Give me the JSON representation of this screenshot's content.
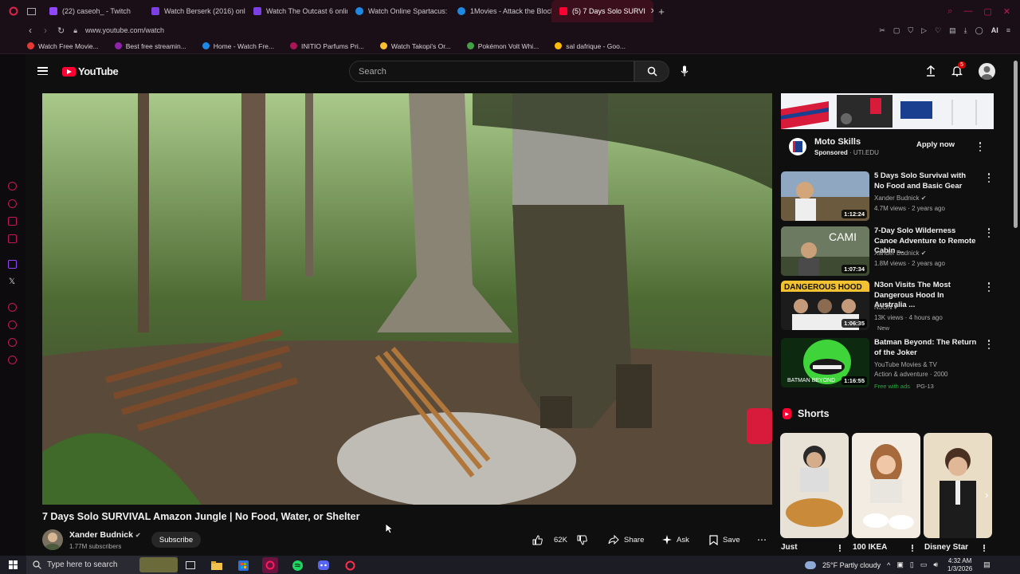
{
  "browser": {
    "tabs": [
      {
        "label": "(22) caseoh_ - Twitch",
        "color": "#9146ff"
      },
      {
        "label": "Watch Berserk (2016) onli",
        "color": "#7b3fe4"
      },
      {
        "label": "Watch The Outcast 6 onlin",
        "color": "#7b3fe4"
      },
      {
        "label": "Watch Online Spartacus: I",
        "color": "#1e88e5"
      },
      {
        "label": "1Movies - Attack the Block",
        "color": "#1e88e5"
      },
      {
        "label": "(5) 7 Days Solo SURVI",
        "color": "#ff0033"
      }
    ],
    "url": "www.youtube.com/watch",
    "bookmarks": [
      {
        "label": "Watch Free Movie...",
        "color": "#e53935"
      },
      {
        "label": "Best free streamin...",
        "color": "#8e24aa"
      },
      {
        "label": "Home - Watch Fre...",
        "color": "#1e88e5"
      },
      {
        "label": "INITIO Parfums Pri...",
        "color": "#ad1457"
      },
      {
        "label": "Watch Takopi's Or...",
        "color": "#fbc02d"
      },
      {
        "label": "Pokémon Volt Whi...",
        "color": "#43a047"
      },
      {
        "label": "sal dafrique - Goo...",
        "color": "#fbbc05"
      }
    ],
    "ai_label": "AI"
  },
  "youtube": {
    "logo": "YouTube",
    "search_placeholder": "Search",
    "notif_count": "5"
  },
  "video": {
    "title": "7 Days Solo SURVIVAL Amazon Jungle | No Food, Water, or Shelter",
    "channel": "Xander Budnick",
    "subscribers": "1.77M subscribers",
    "subscribe_label": "Subscribe",
    "likes": "62K",
    "share_label": "Share",
    "ask_label": "Ask",
    "save_label": "Save"
  },
  "ad": {
    "title": "Moto Skills",
    "sponsored": "Sponsored",
    "domain": "· UTI.EDU",
    "cta": "Apply now"
  },
  "recommendations": [
    {
      "title": "5 Days Solo Survival with No Food and Basic Gear",
      "channel": "Xander Budnick",
      "meta": "4.7M views · 2 years ago",
      "duration": "1:12:24"
    },
    {
      "title": "7-Day Solo Wilderness Canoe Adventure to Remote Cabin ...",
      "channel": "Xander Budnick",
      "meta": "1.8M views · 2 years ago",
      "duration": "1:07:34"
    },
    {
      "title": "N3on Visits The Most Dangerous Hood In Australia ...",
      "channel": "N3ON",
      "meta": "13K views · 4 hours ago",
      "badge": "New",
      "duration": "1:06:35"
    },
    {
      "title": "Batman Beyond: The Return of the Joker",
      "channel": "YouTube Movies & TV",
      "meta": "Action & adventure · 2000",
      "badge": "Free with ads",
      "rating": "PG-13",
      "duration": "1:16:55"
    }
  ],
  "shorts": {
    "heading": "Shorts",
    "items": [
      {
        "label": "Just"
      },
      {
        "label": "100 IKEA"
      },
      {
        "label": "Disney Star"
      }
    ]
  },
  "taskbar": {
    "search_placeholder": "Type here to search",
    "weather": "25°F  Partly cloudy",
    "time": "4:32 AM",
    "date": "1/3/2026"
  }
}
